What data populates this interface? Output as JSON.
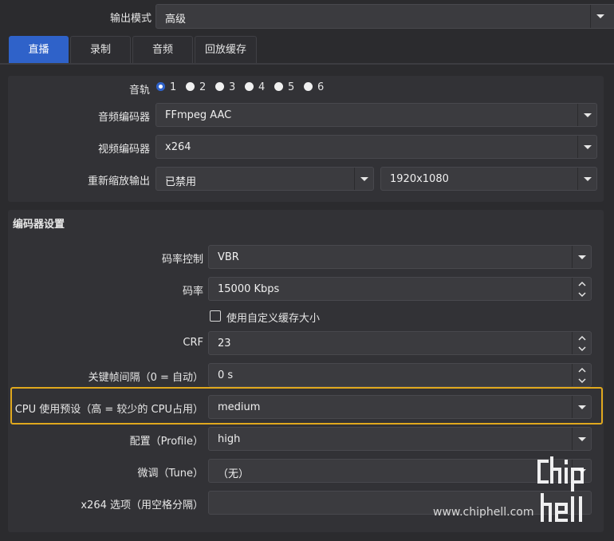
{
  "output_mode": {
    "label": "输出模式",
    "value": "高级"
  },
  "tabs": [
    "直播",
    "录制",
    "音频",
    "回放缓存"
  ],
  "stream": {
    "track_label": "音轨",
    "tracks": [
      "1",
      "2",
      "3",
      "4",
      "5",
      "6"
    ],
    "selected_track": "1",
    "audio_encoder_label": "音频编码器",
    "audio_encoder": "FFmpeg AAC",
    "video_encoder_label": "视频编码器",
    "video_encoder": "x264",
    "rescale_label": "重新缩放输出",
    "rescale_value": "已禁用",
    "rescale_resolution": "1920x1080"
  },
  "encoder_settings": {
    "title": "编码器设置",
    "rate_control_label": "码率控制",
    "rate_control": "VBR",
    "bitrate_label": "码率",
    "bitrate": "15000 Kbps",
    "custom_buffer_label": "使用自定义缓存大小",
    "crf_label": "CRF",
    "crf": "23",
    "keyframe_label": "关键帧间隔（0 = 自动）",
    "keyframe": "0 s",
    "preset_label": "CPU 使用预设（高 = 较少的 CPU占用）",
    "preset": "medium",
    "profile_label": "配置（Profile）",
    "profile": "high",
    "tune_label": "微调（Tune）",
    "tune": "（无）",
    "options_label": "x264 选项（用空格分隔）",
    "options": ""
  },
  "watermark": {
    "text": "www.chiphell.com",
    "logo_text": "chiphell"
  },
  "colors": {
    "accent": "#2f62c9",
    "highlight": "#e0a81e",
    "bg": "#2b2b2e"
  }
}
